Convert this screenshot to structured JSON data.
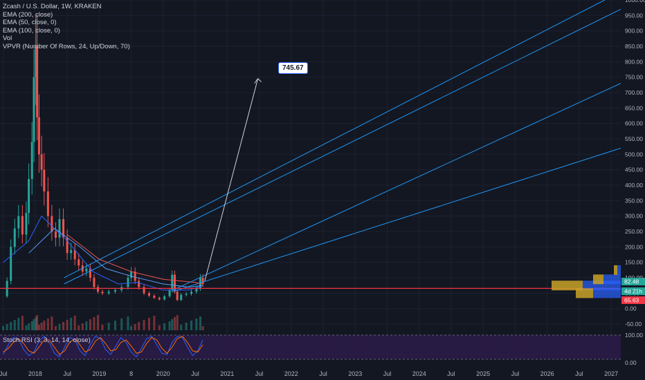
{
  "header": {
    "symbol_line": "Zcash / U.S. Dollar, 1W, KRAKEN",
    "indicators": [
      "EMA (200, close)",
      "EMA (50, close, 0)",
      "EMA (100, close, 0)",
      "Vol",
      "VPVR (Number Of Rows, 24, Up/Down, 70)"
    ]
  },
  "oscillator": {
    "label": "Stoch RSI (3, 3, 14, 14, close)"
  },
  "annotation": {
    "target_label": "745.67"
  },
  "colors": {
    "background": "#131722",
    "grid": "#1e2230",
    "up": "#26a69a",
    "down": "#ef5350",
    "fan": "#2196f3",
    "support": "#f23645",
    "ema200": "#ef5350",
    "ema50": "#2962ff",
    "ema100": "#5b9cf6",
    "rsi_bg": "#2a1b47"
  },
  "price_tags": [
    {
      "label": "82.48",
      "color": "#26a69a"
    },
    {
      "label": "4d 21h",
      "color": "#26a69a"
    },
    {
      "label": "65.63",
      "color": "#f23645"
    }
  ],
  "chart_data": {
    "type": "line",
    "title": "Zcash / U.S. Dollar, 1W, KRAKEN",
    "y_ticks": [
      -50,
      0,
      50,
      100,
      150,
      200,
      250,
      300,
      350,
      400,
      450,
      500,
      550,
      600,
      650,
      700,
      750,
      800,
      850,
      900,
      950,
      1000
    ],
    "y_tick_labels": [
      "-50.00",
      "0.00",
      "50.00",
      "100.00",
      "150.00",
      "200.00",
      "250.00",
      "300.00",
      "350.00",
      "400.00",
      "450.00",
      "500.00",
      "550.00",
      "600.00",
      "650.00",
      "700.00",
      "750.00",
      "800.00",
      "850.00",
      "900.00",
      "950.00",
      "1000.00"
    ],
    "ylim": [
      -70,
      1000
    ],
    "x_ticks": [
      {
        "label": "Jul",
        "t": 2017.5
      },
      {
        "label": "2018",
        "t": 2018.0
      },
      {
        "label": "Jul",
        "t": 2018.5
      },
      {
        "label": "2019",
        "t": 2019.0
      },
      {
        "label": "8",
        "t": 2019.5
      },
      {
        "label": "2020",
        "t": 2020.0
      },
      {
        "label": "Jul",
        "t": 2020.5
      },
      {
        "label": "2021",
        "t": 2021.0
      },
      {
        "label": "Jul",
        "t": 2021.5
      },
      {
        "label": "2022",
        "t": 2022.0
      },
      {
        "label": "Jul",
        "t": 2022.5
      },
      {
        "label": "2023",
        "t": 2023.0
      },
      {
        "label": "Jul",
        "t": 2023.5
      },
      {
        "label": "2024",
        "t": 2024.0
      },
      {
        "label": "Jul",
        "t": 2024.5
      },
      {
        "label": "2025",
        "t": 2025.0
      },
      {
        "label": "Jul",
        "t": 2025.5
      },
      {
        "label": "2026",
        "t": 2026.0
      },
      {
        "label": "Jul",
        "t": 2026.5
      },
      {
        "label": "2027",
        "t": 2027.0
      }
    ],
    "xlim": [
      2017.45,
      2027.15
    ],
    "price_series": {
      "name": "ZEC/USD weekly",
      "points": [
        [
          2017.5,
          40
        ],
        [
          2017.56,
          90
        ],
        [
          2017.62,
          200
        ],
        [
          2017.68,
          260
        ],
        [
          2017.74,
          300
        ],
        [
          2017.8,
          240
        ],
        [
          2017.86,
          310
        ],
        [
          2017.9,
          420
        ],
        [
          2017.95,
          540
        ],
        [
          2017.98,
          750
        ],
        [
          2018.01,
          850
        ],
        [
          2018.03,
          620
        ],
        [
          2018.06,
          500
        ],
        [
          2018.1,
          450
        ],
        [
          2018.14,
          380
        ],
        [
          2018.2,
          300
        ],
        [
          2018.26,
          250
        ],
        [
          2018.32,
          230
        ],
        [
          2018.38,
          290
        ],
        [
          2018.44,
          230
        ],
        [
          2018.5,
          180
        ],
        [
          2018.56,
          190
        ],
        [
          2018.62,
          160
        ],
        [
          2018.68,
          140
        ],
        [
          2018.74,
          120
        ],
        [
          2018.8,
          130
        ],
        [
          2018.86,
          100
        ],
        [
          2018.92,
          70
        ],
        [
          2018.98,
          55
        ],
        [
          2019.05,
          50
        ],
        [
          2019.15,
          55
        ],
        [
          2019.25,
          60
        ],
        [
          2019.35,
          70
        ],
        [
          2019.45,
          100
        ],
        [
          2019.5,
          120
        ],
        [
          2019.56,
          90
        ],
        [
          2019.62,
          70
        ],
        [
          2019.7,
          50
        ],
        [
          2019.78,
          42
        ],
        [
          2019.86,
          35
        ],
        [
          2019.94,
          30
        ],
        [
          2020.02,
          40
        ],
        [
          2020.1,
          60
        ],
        [
          2020.14,
          110
        ],
        [
          2020.18,
          55
        ],
        [
          2020.22,
          28
        ],
        [
          2020.28,
          45
        ],
        [
          2020.36,
          48
        ],
        [
          2020.44,
          55
        ],
        [
          2020.52,
          65
        ],
        [
          2020.58,
          100
        ],
        [
          2020.62,
          80
        ]
      ]
    },
    "ema_series": [
      {
        "name": "EMA (200, close)",
        "points": [
          [
            2018.5,
            240
          ],
          [
            2019.0,
            160
          ],
          [
            2019.5,
            120
          ],
          [
            2020.0,
            95
          ],
          [
            2020.5,
            85
          ],
          [
            2020.62,
            80
          ]
        ]
      },
      {
        "name": "EMA (50, close, 0)",
        "points": [
          [
            2017.5,
            150
          ],
          [
            2017.9,
            220
          ],
          [
            2018.1,
            300
          ],
          [
            2018.5,
            220
          ],
          [
            2018.9,
            120
          ],
          [
            2019.3,
            80
          ],
          [
            2019.6,
            85
          ],
          [
            2020.0,
            60
          ],
          [
            2020.4,
            60
          ],
          [
            2020.62,
            75
          ]
        ]
      },
      {
        "name": "EMA (100, close, 0)",
        "points": [
          [
            2017.9,
            180
          ],
          [
            2018.3,
            260
          ],
          [
            2018.7,
            200
          ],
          [
            2019.1,
            130
          ],
          [
            2019.5,
            105
          ],
          [
            2020.0,
            80
          ],
          [
            2020.4,
            70
          ],
          [
            2020.62,
            75
          ]
        ]
      }
    ],
    "fan_lines": [
      {
        "from": [
          2018.45,
          100
        ],
        "to": [
          2026.9,
          1000
        ]
      },
      {
        "from": [
          2018.45,
          80
        ],
        "to": [
          2027.15,
          970
        ]
      },
      {
        "from": [
          2020.15,
          60
        ],
        "to": [
          2027.15,
          730
        ]
      },
      {
        "from": [
          2020.15,
          55
        ],
        "to": [
          2027.15,
          520
        ]
      }
    ],
    "arrow": {
      "from": [
        2020.65,
        90
      ],
      "to": [
        2021.48,
        745.67
      ]
    },
    "support_level": 65.63,
    "current_price": 82.48,
    "volume_profile": [
      {
        "price": 75,
        "up": 0.45,
        "down": 0.55
      },
      {
        "price": 95,
        "up": 0.15,
        "down": 0.25
      },
      {
        "price": 50,
        "up": 0.25,
        "down": 0.4
      },
      {
        "price": 125,
        "up": 0.05,
        "down": 0.05
      }
    ],
    "oscillator_name": "Stoch RSI (3, 3, 14, 14, close)",
    "oscillator_ylim": [
      0,
      100
    ],
    "oscillator_ticks": [
      "100.00",
      "0.00"
    ],
    "oscillator_k": [
      20,
      60,
      90,
      85,
      40,
      15,
      30,
      75,
      95,
      70,
      25,
      10,
      50,
      90,
      80,
      35,
      15,
      60,
      95,
      85,
      40,
      20,
      55,
      90,
      70,
      30,
      10,
      45,
      85,
      95,
      60,
      25,
      20,
      70,
      95,
      90,
      50,
      15,
      35,
      80
    ],
    "oscillator_d": [
      30,
      45,
      70,
      85,
      65,
      35,
      25,
      50,
      80,
      80,
      50,
      20,
      35,
      70,
      85,
      60,
      30,
      40,
      75,
      90,
      65,
      35,
      40,
      70,
      80,
      55,
      25,
      30,
      65,
      90,
      80,
      45,
      25,
      50,
      85,
      95,
      70,
      35,
      30,
      60
    ]
  }
}
